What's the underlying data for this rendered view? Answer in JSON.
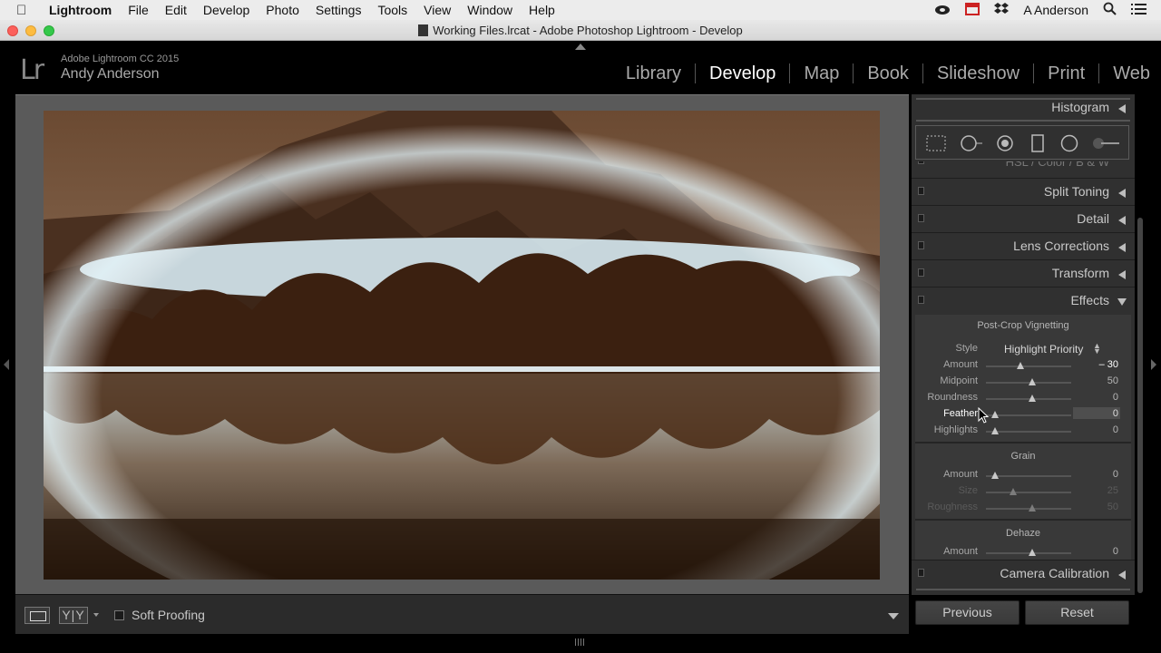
{
  "menubar": {
    "app": "Lightroom",
    "items": [
      "File",
      "Edit",
      "Develop",
      "Photo",
      "Settings",
      "Tools",
      "View",
      "Window",
      "Help"
    ],
    "user": "A Anderson"
  },
  "window": {
    "title": "Working Files.lrcat - Adobe Photoshop Lightroom - Develop"
  },
  "identity": {
    "logo": "Lr",
    "product": "Adobe Lightroom CC 2015",
    "user": "Andy Anderson"
  },
  "modules": {
    "items": [
      "Library",
      "Develop",
      "Map",
      "Book",
      "Slideshow",
      "Print",
      "Web"
    ],
    "active": "Develop"
  },
  "toolbar": {
    "yy_label": "Y|Y",
    "soft_proofing_label": "Soft Proofing",
    "soft_proofing_checked": false
  },
  "panel": {
    "histogram": "Histogram",
    "hsl_faded": "HSL / Color / B & W",
    "split_toning": "Split Toning",
    "detail": "Detail",
    "lens_corrections": "Lens Corrections",
    "transform": "Transform",
    "effects": "Effects",
    "camera_calibration": "Camera Calibration",
    "vignette": {
      "title": "Post-Crop Vignetting",
      "style_label": "Style",
      "style_value": "Highlight Priority",
      "rows": [
        {
          "label": "Amount",
          "value": "– 30"
        },
        {
          "label": "Midpoint",
          "value": "50"
        },
        {
          "label": "Roundness",
          "value": "0"
        },
        {
          "label": "Feather",
          "value": "0"
        },
        {
          "label": "Highlights",
          "value": "0"
        }
      ]
    },
    "grain": {
      "title": "Grain",
      "rows": [
        {
          "label": "Amount",
          "value": "0"
        },
        {
          "label": "Size",
          "value": "25"
        },
        {
          "label": "Roughness",
          "value": "50"
        }
      ]
    },
    "dehaze": {
      "title": "Dehaze",
      "rows": [
        {
          "label": "Amount",
          "value": "0"
        }
      ]
    },
    "previous_label": "Previous",
    "reset_label": "Reset"
  },
  "icons": [
    "apple-icon",
    "creative-cloud-icon",
    "calendar-icon",
    "dropbox-icon",
    "search-icon",
    "list-icon"
  ],
  "colors": {
    "panel_bg": "#303030",
    "sepia_dark": "#2a1608",
    "glow": "#dff6ff"
  }
}
